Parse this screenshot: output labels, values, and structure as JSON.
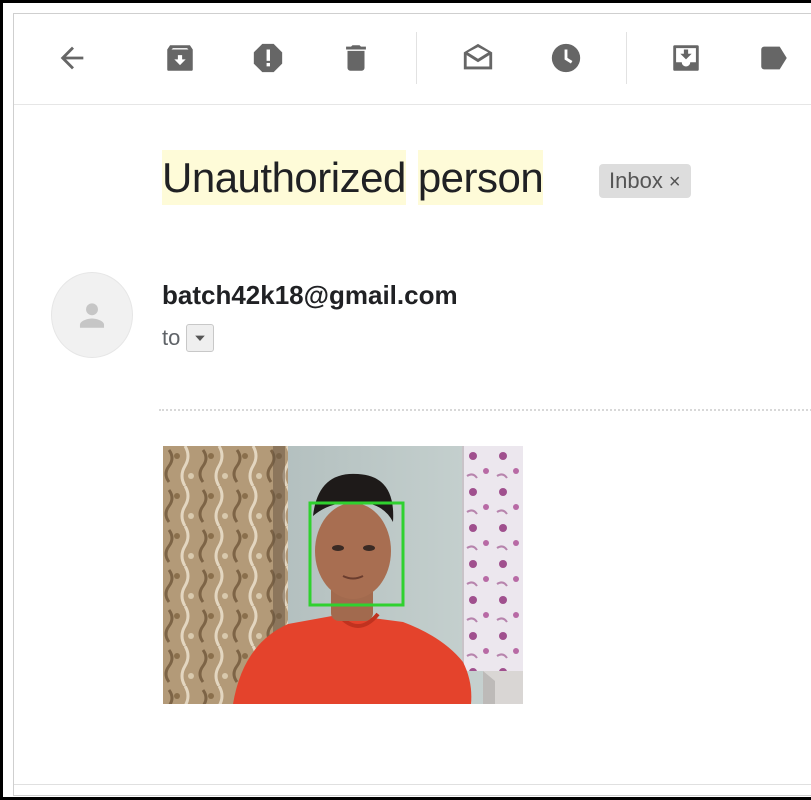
{
  "toolbar": {
    "icons": [
      "back-arrow-icon",
      "archive-icon",
      "report-spam-icon",
      "delete-icon",
      "mark-unread-icon",
      "snooze-icon",
      "move-to-icon",
      "label-icon"
    ]
  },
  "message": {
    "subject_word1": "Unauthorized",
    "subject_word2": "person",
    "label_chip": "Inbox",
    "label_chip_remove": "×",
    "sender_email": "batch42k18@gmail.com",
    "to_label": "to"
  },
  "colors": {
    "subject_highlight": "#fefbd8",
    "face_box": "#2fd12f",
    "shirt": "#e4432c"
  }
}
